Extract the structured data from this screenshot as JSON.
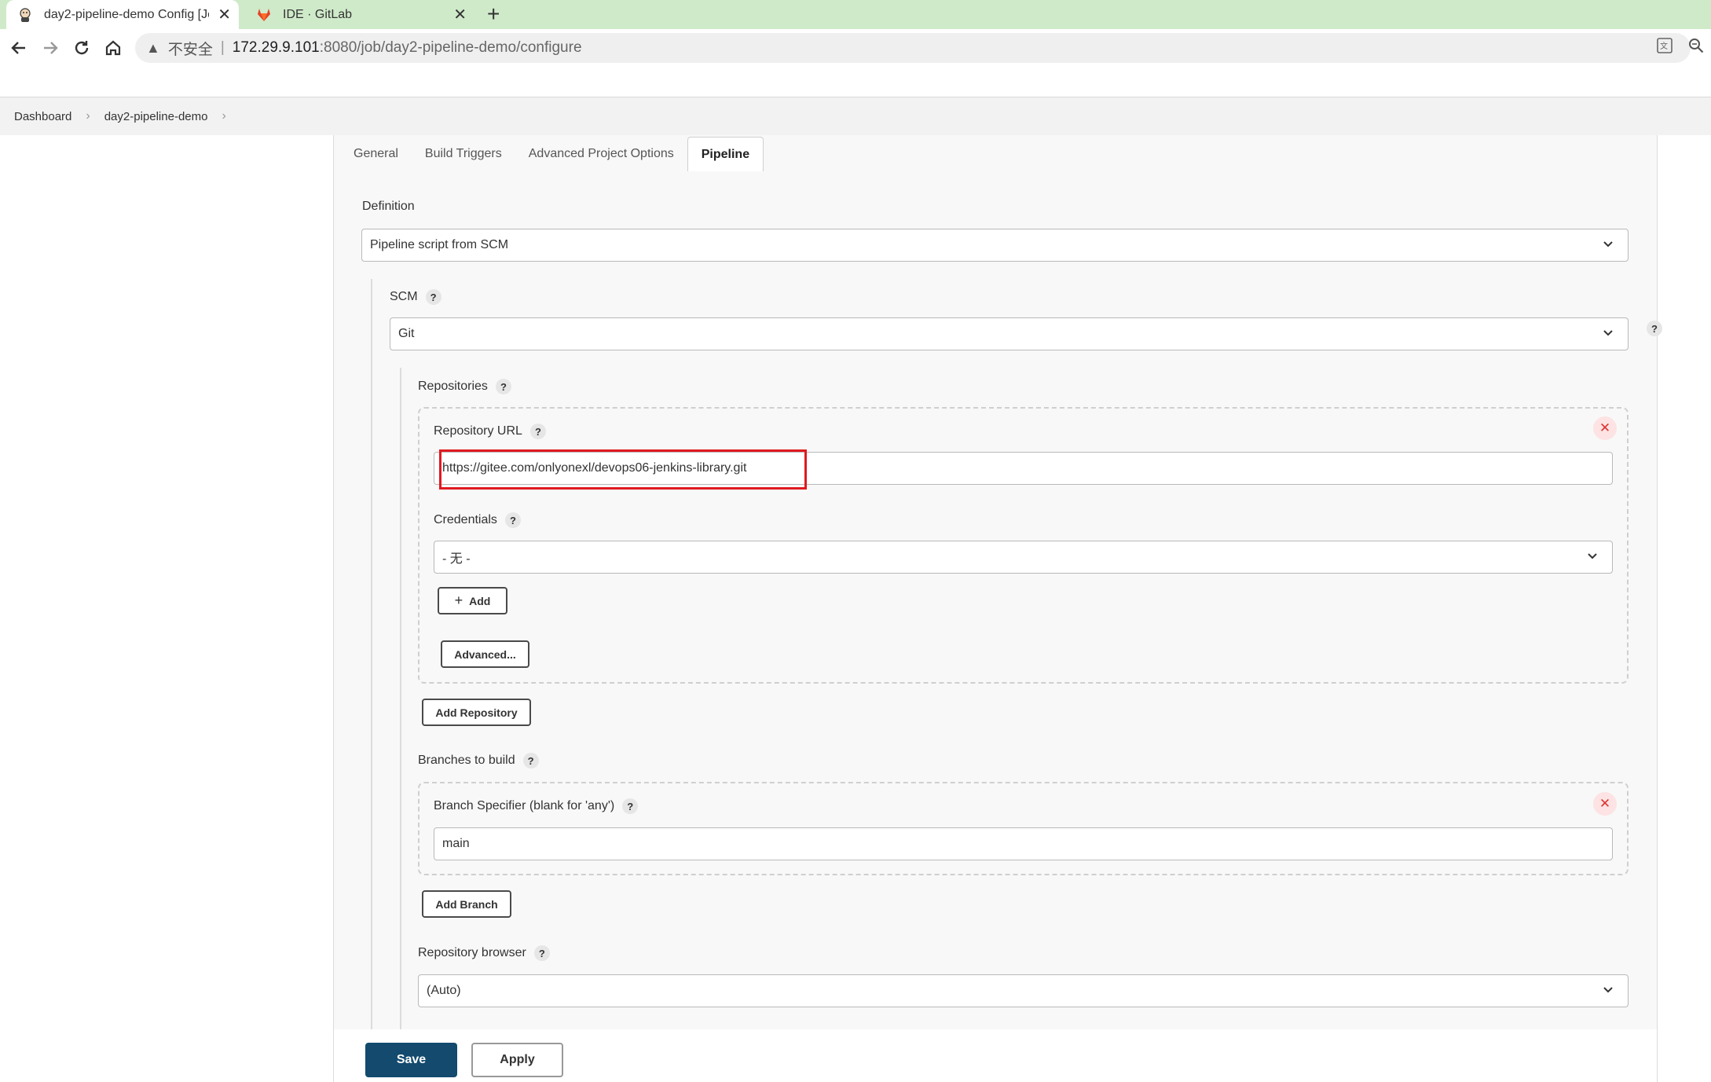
{
  "browser": {
    "tabs": [
      {
        "title": "day2-pipeline-demo Config [Je",
        "active": true
      },
      {
        "title": "IDE · GitLab",
        "active": false
      }
    ],
    "address": {
      "security": "不安全",
      "separator": "|",
      "host": "172.29.9.101",
      "path": ":8080/job/day2-pipeline-demo/configure"
    }
  },
  "breadcrumb": [
    "Dashboard",
    "day2-pipeline-demo"
  ],
  "config_tabs": [
    "General",
    "Build Triggers",
    "Advanced Project Options",
    "Pipeline"
  ],
  "pipeline": {
    "definition_label": "Definition",
    "definition_value": "Pipeline script from SCM",
    "scm_label": "SCM",
    "scm_value": "Git",
    "repositories_label": "Repositories",
    "repo_url_label": "Repository URL",
    "repo_url_value": "https://gitee.com/onlyonexl/devops06-jenkins-library.git",
    "credentials_label": "Credentials",
    "credentials_value": "- 无 -",
    "add_label": "Add",
    "advanced_label": "Advanced...",
    "add_repository_label": "Add Repository",
    "branches_label": "Branches to build",
    "branch_specifier_label": "Branch Specifier (blank for 'any')",
    "branch_specifier_value": "main",
    "add_branch_label": "Add Branch",
    "repo_browser_label": "Repository browser",
    "repo_browser_value": "(Auto)"
  },
  "help_glyph": "?",
  "delete_glyph": "✕",
  "actions": {
    "save": "Save",
    "apply": "Apply"
  },
  "colors": {
    "tabstrip": "#cfeac9",
    "save_button": "#134a6e",
    "highlight": "#e0191f"
  }
}
